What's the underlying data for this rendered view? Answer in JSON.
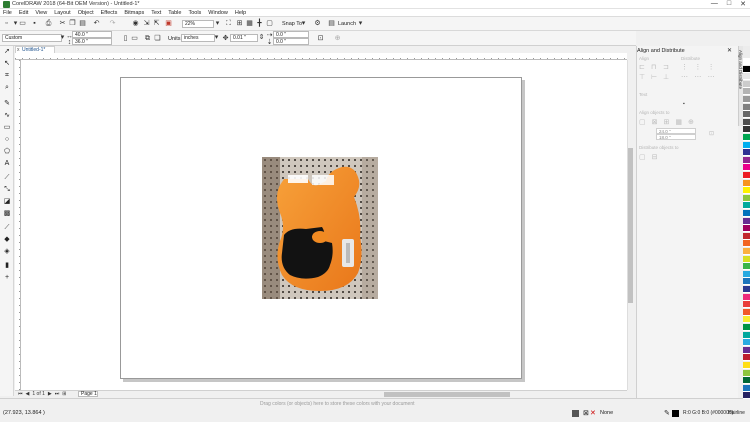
{
  "window": {
    "title": "CorelDRAW 2018 (64-Bit OEM Version) - Untitled-1*",
    "minimize": "—",
    "maximize": "□",
    "close": "✕"
  },
  "menu": [
    "File",
    "Edit",
    "View",
    "Layout",
    "Object",
    "Effects",
    "Bitmaps",
    "Text",
    "Table",
    "Tools",
    "Window",
    "Help"
  ],
  "standard_toolbar": {
    "zoom_value": "22%",
    "snap_to_label": "Snap To",
    "launch_label": "Launch"
  },
  "property_bar": {
    "page_size": "Custom",
    "width_value": "40.0 \"",
    "height_value": "36.0 \"",
    "units_label": "Units:",
    "units_value": "inches",
    "nudge_value": "0.01 \"",
    "dup_x": "0.0 \"",
    "dup_y": "0.0 \""
  },
  "document_tab": {
    "label": "Untitled-1*",
    "close": "x"
  },
  "page_nav": {
    "first": "⏮",
    "prev": "◀",
    "counter": "1 of 1",
    "next": "▶",
    "last": "⏭",
    "add": "⊞",
    "page_tab": "Page 1"
  },
  "status": {
    "coordinates": "(27.923, 13.864 )",
    "hint": "Drag colors (or objects) here to store these colors with your document",
    "fill_label": "None",
    "outline_color": "R:0 G:0 B:0 (#000000)",
    "outline_width": "Hairline"
  },
  "docker": {
    "title": "Align and Distribute",
    "tab_label": "Align and Distribute",
    "align_label": "Align",
    "distribute_label": "Distribute",
    "text_label": "Text",
    "align_objects_to": "Align objects to",
    "spacing_h": "24.0 \"",
    "spacing_v": "18.0 \"",
    "distribute_objects_to": "Distribute objects to"
  },
  "palette_colors": [
    "#ffffff",
    "#000000",
    "#e6e6e6",
    "#cccccc",
    "#b3b3b3",
    "#999999",
    "#808080",
    "#666666",
    "#4d4d4d",
    "#333333",
    "#00a651",
    "#00aeef",
    "#2e3192",
    "#92278f",
    "#ec008c",
    "#ed1c24",
    "#f7941d",
    "#fff200",
    "#8dc63f",
    "#00a99d",
    "#0072bc",
    "#662d91",
    "#9e005d",
    "#c1272d",
    "#f26522",
    "#fbb040",
    "#d7df23",
    "#39b54a",
    "#27aae1",
    "#1c75bc",
    "#2b3990",
    "#ee2a7b",
    "#e93e3a",
    "#f15a29",
    "#f9ed32",
    "#009444",
    "#00a79d",
    "#29abe2",
    "#662d91",
    "#be1e2d",
    "#ffde17",
    "#8dc63f",
    "#006838",
    "#1b75bc",
    "#262262"
  ],
  "colors": {
    "accent": "#1a4f8b",
    "guitar_body": "#f28a1e",
    "pickguard": "#111111"
  }
}
